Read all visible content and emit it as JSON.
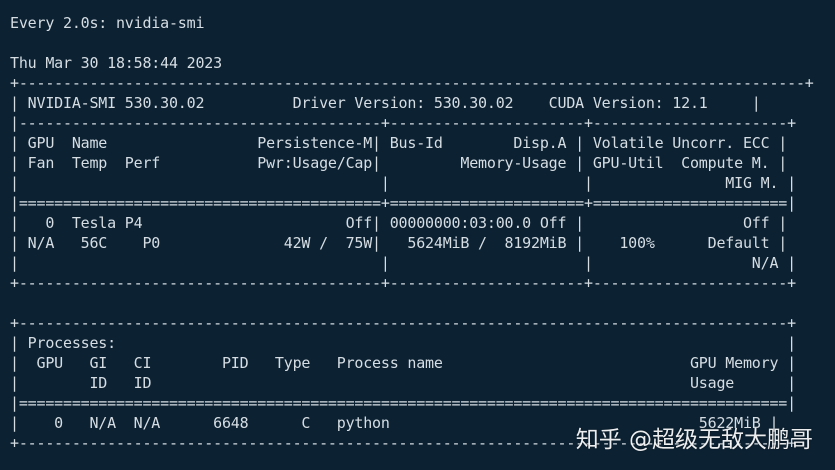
{
  "terminal": {
    "lines": [
      "Every 2.0s: nvidia-smi",
      "",
      "Thu Mar 30 18:58:44 2023",
      "",
      "| NVIDIA-SMI 530.30.02          Driver Version: 530.30.02    CUDA Version: 12.1     |",
      "|-----------------------------------------+----------------------+----------------------+",
      "| GPU  Name                 Persistence-M| Bus-Id        Disp.A | Volatile Uncorr. ECC |",
      "| Fan  Temp  Perf           Pwr:Usage/Cap|         Memory-Usage | GPU-Util  Compute M. |",
      "|                                         |                      |               MIG M. |",
      "|=========================================+======================+======================|",
      "|   0  Tesla P4                       Off| 00000000:03:00.0 Off |                  Off |",
      "| N/A   56C    P0              42W /  75W|   5624MiB /  8192MiB |    100%      Default |",
      "|                                         |                      |                  N/A |",
      "+-----------------------------------------+----------------------+----------------------+",
      "",
      "+---------------------------------------------------------------------------------------+",
      "| Processes:                                                                            |",
      "|  GPU   GI   CI        PID   Type   Process name                            GPU Memory |",
      "|        ID   ID                                                             Usage      |",
      "|=======================================================================================|",
      "|    0   N/A  N/A      6648      C   python                                   5622MiB |",
      "+---------------------------------------------------------------------------------------+"
    ]
  },
  "watermark": {
    "text": "知乎 @超级无敌大鹏哥"
  },
  "colors": {
    "background": "#0c2233",
    "text": "#d6dde3"
  }
}
